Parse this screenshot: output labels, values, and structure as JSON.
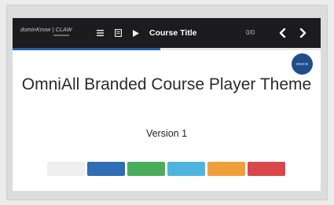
{
  "toolbar": {
    "logo_text": "dominKnow | CLAW",
    "menu_icon": "menu-icon",
    "document_icon": "document-icon",
    "play_icon": "play-icon",
    "course_title": "Course Title",
    "page_count": "0/0",
    "prev_icon": "chevron-left-icon",
    "next_icon": "chevron-right-icon"
  },
  "progress": {
    "fraction": 0.48
  },
  "badge": {
    "text": "WEBIN"
  },
  "content": {
    "title": "OmniAll Branded Course Player Theme",
    "version": "Version 1"
  },
  "swatches": [
    {
      "name": "light-gray",
      "color": "#efefef"
    },
    {
      "name": "blue",
      "color": "#2f6db5"
    },
    {
      "name": "green",
      "color": "#4aad5b"
    },
    {
      "name": "light-blue",
      "color": "#4db5dd"
    },
    {
      "name": "orange",
      "color": "#f0a03a"
    },
    {
      "name": "red",
      "color": "#d9474a"
    }
  ],
  "colors": {
    "toolbar_bg": "#1c1c1e",
    "accent": "#2a5fa8"
  }
}
